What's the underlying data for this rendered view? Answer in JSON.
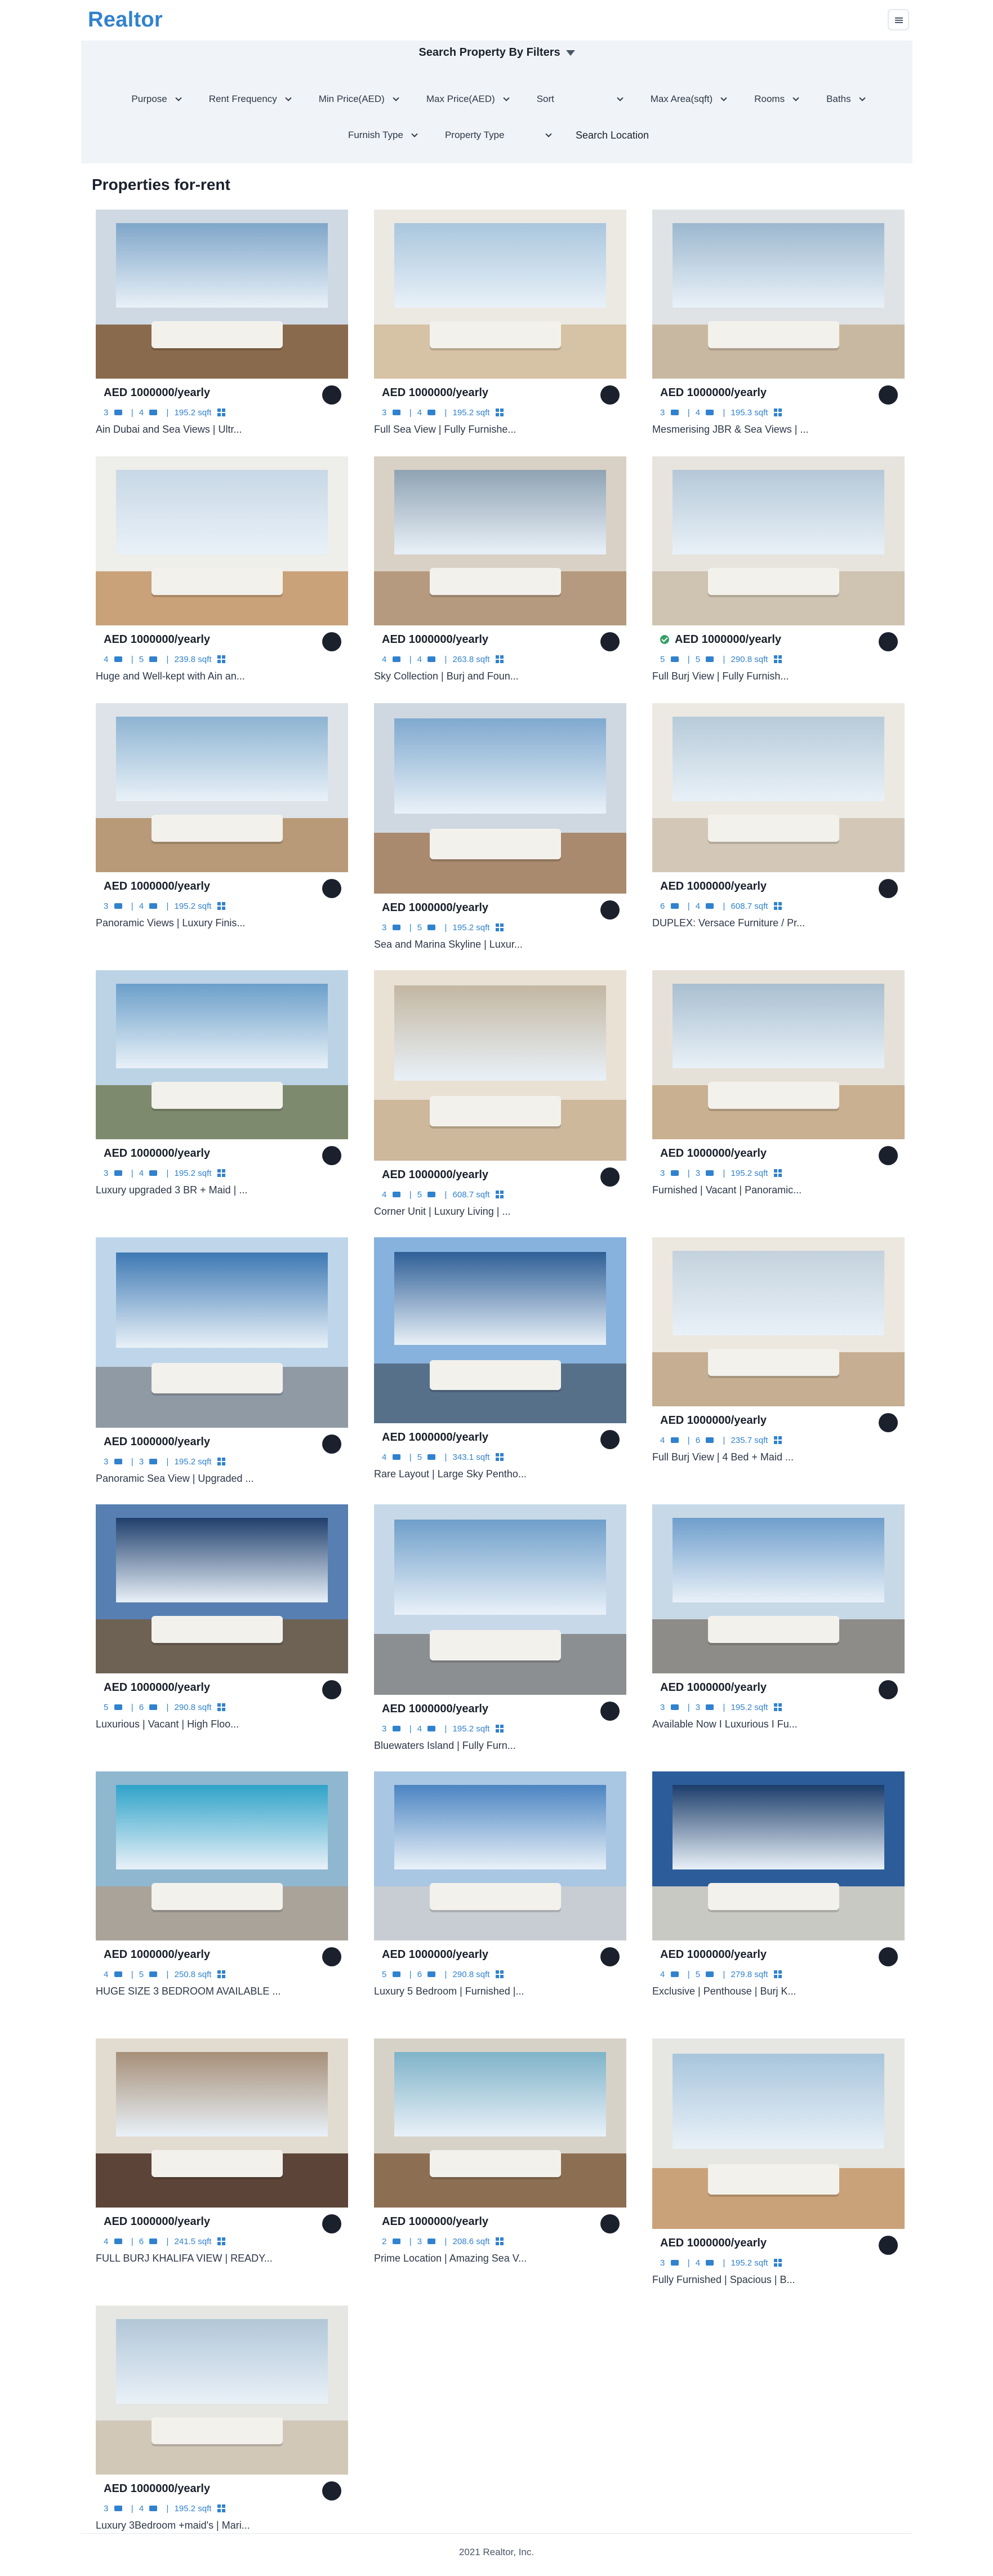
{
  "brand": "Realtor",
  "filters": {
    "title": "Search Property By Filters",
    "row1": [
      "Purpose",
      "Rent Frequency",
      "Min Price(AED)",
      "Max Price(AED)",
      "Sort",
      "Max Area(sqft)",
      "Rooms",
      "Baths"
    ],
    "row2": [
      "Furnish Type",
      "Property Type"
    ],
    "location_button": "Search Location"
  },
  "section_title": "Properties for-rent",
  "listings": [
    {
      "price": "AED 1000000/yearly",
      "rooms": "3",
      "baths": "4",
      "area": "195.2 sqft",
      "title": "Ain Dubai and Sea Views | Ultr...",
      "verified": false
    },
    {
      "price": "AED 1000000/yearly",
      "rooms": "3",
      "baths": "4",
      "area": "195.2 sqft",
      "title": "Full Sea View | Fully Furnishe...",
      "verified": false
    },
    {
      "price": "AED 1000000/yearly",
      "rooms": "3",
      "baths": "4",
      "area": "195.3 sqft",
      "title": "Mesmerising JBR & Sea Views | ...",
      "verified": false
    },
    {
      "price": "AED 1000000/yearly",
      "rooms": "4",
      "baths": "5",
      "area": "239.8 sqft",
      "title": "Huge and Well-kept with Ain an...",
      "verified": false
    },
    {
      "price": "AED 1000000/yearly",
      "rooms": "4",
      "baths": "4",
      "area": "263.8 sqft",
      "title": "Sky Collection | Burj and Foun...",
      "verified": false
    },
    {
      "price": "AED 1000000/yearly",
      "rooms": "5",
      "baths": "5",
      "area": "290.8 sqft",
      "title": "Full Burj View | Fully Furnish...",
      "verified": true
    },
    {
      "price": "AED 1000000/yearly",
      "rooms": "3",
      "baths": "4",
      "area": "195.2 sqft",
      "title": "Panoramic Views | Luxury Finis...",
      "verified": false
    },
    {
      "price": "AED 1000000/yearly",
      "rooms": "3",
      "baths": "5",
      "area": "195.2 sqft",
      "title": "Sea and Marina Skyline | Luxur...",
      "verified": false
    },
    {
      "price": "AED 1000000/yearly",
      "rooms": "6",
      "baths": "4",
      "area": "608.7 sqft",
      "title": "DUPLEX: Versace Furniture / Pr...",
      "verified": false
    },
    {
      "price": "AED 1000000/yearly",
      "rooms": "3",
      "baths": "4",
      "area": "195.2 sqft",
      "title": "Luxury upgraded 3 BR + Maid | ...",
      "verified": false
    },
    {
      "price": "AED 1000000/yearly",
      "rooms": "4",
      "baths": "5",
      "area": "608.7 sqft",
      "title": "Corner Unit | Luxury Living | ...",
      "verified": false
    },
    {
      "price": "AED 1000000/yearly",
      "rooms": "3",
      "baths": "3",
      "area": "195.2 sqft",
      "title": "Furnished | Vacant | Panoramic...",
      "verified": false
    },
    {
      "price": "AED 1000000/yearly",
      "rooms": "3",
      "baths": "3",
      "area": "195.2 sqft",
      "title": "Panoramic Sea View | Upgraded ...",
      "verified": false
    },
    {
      "price": "AED 1000000/yearly",
      "rooms": "4",
      "baths": "5",
      "area": "343.1 sqft",
      "title": "Rare Layout | Large Sky Pentho...",
      "verified": false
    },
    {
      "price": "AED 1000000/yearly",
      "rooms": "4",
      "baths": "6",
      "area": "235.7 sqft",
      "title": "Full Burj View | 4 Bed + Maid ...",
      "verified": false
    },
    {
      "price": "AED 1000000/yearly",
      "rooms": "5",
      "baths": "6",
      "area": "290.8 sqft",
      "title": "Luxurious | Vacant | High Floo...",
      "verified": false
    },
    {
      "price": "AED 1000000/yearly",
      "rooms": "3",
      "baths": "4",
      "area": "195.2 sqft",
      "title": "Bluewaters Island | Fully Furn...",
      "verified": false
    },
    {
      "price": "AED 1000000/yearly",
      "rooms": "3",
      "baths": "3",
      "area": "195.2 sqft",
      "title": "Available Now I Luxurious I Fu...",
      "verified": false
    },
    {
      "price": "AED 1000000/yearly",
      "rooms": "4",
      "baths": "5",
      "area": "250.8 sqft",
      "title": "HUGE SIZE 3 BEDROOM AVAILABLE ...",
      "verified": false
    },
    {
      "price": "AED 1000000/yearly",
      "rooms": "5",
      "baths": "6",
      "area": "290.8 sqft",
      "title": "Luxury 5 Bedroom | Furnished |...",
      "verified": false
    },
    {
      "price": "AED 1000000/yearly",
      "rooms": "4",
      "baths": "5",
      "area": "279.8 sqft",
      "title": "Exclusive | Penthouse | Burj K...",
      "verified": false
    },
    {
      "price": "AED 1000000/yearly",
      "rooms": "4",
      "baths": "6",
      "area": "241.5 sqft",
      "title": "FULL BURJ KHALIFA VIEW | READY...",
      "verified": false
    },
    {
      "price": "AED 1000000/yearly",
      "rooms": "2",
      "baths": "3",
      "area": "208.6 sqft",
      "title": "Prime Location | Amazing Sea V...",
      "verified": false
    },
    {
      "price": "AED 1000000/yearly",
      "rooms": "3",
      "baths": "4",
      "area": "195.2 sqft",
      "title": "Fully Furnished | Spacious | B...",
      "verified": false
    },
    {
      "price": "AED 1000000/yearly",
      "rooms": "3",
      "baths": "4",
      "area": "195.2 sqft",
      "title": "Luxury 3Bedroom +maid's | Mari...",
      "verified": false
    }
  ],
  "footer": "2021 Realtor, Inc."
}
